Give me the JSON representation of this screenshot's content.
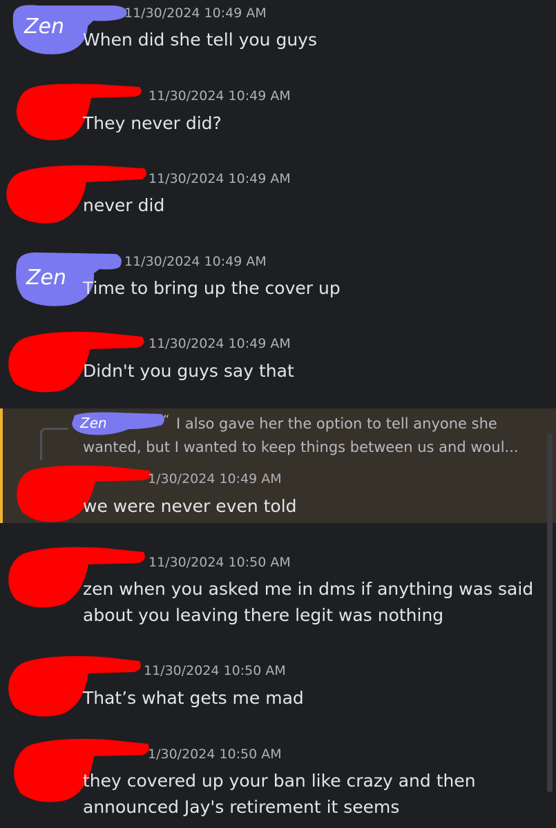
{
  "messages": [
    {
      "author": "Zen",
      "timestamp": "11/30/2024 10:49 AM",
      "lines": [
        "When did she tell you guys"
      ]
    },
    {
      "author": "",
      "timestamp": "11/30/2024 10:49 AM",
      "lines": [
        "They never did?"
      ]
    },
    {
      "author": "",
      "timestamp": "11/30/2024 10:49 AM",
      "lines": [
        "never did"
      ]
    },
    {
      "author": "Zen",
      "timestamp": "11/30/2024 10:49 AM",
      "lines": [
        "Time to bring up the cover up"
      ]
    },
    {
      "author": "",
      "timestamp": "11/30/2024 10:49 AM",
      "lines": [
        "Didn't you guys say that"
      ]
    },
    {
      "author": "",
      "timestamp": "1/30/2024 10:49 AM",
      "lines": [
        "we were never even told"
      ],
      "reply": {
        "author": "Zen",
        "quote_mark": "“",
        "text": "I also gave her the option to tell anyone she wanted, but I wanted to keep things between us and woul..."
      }
    },
    {
      "author": "",
      "timestamp": "11/30/2024 10:50 AM",
      "lines": [
        "zen when you asked me in dms if anything was said",
        "about you leaving there legit was nothing"
      ]
    },
    {
      "author": "",
      "timestamp": "11/30/2024 10:50 AM",
      "lines": [
        "That’s what gets me mad"
      ]
    },
    {
      "author": "",
      "timestamp": "1/30/2024 10:50 AM",
      "lines": [
        "they covered up your ban like crazy and then",
        "announced Jay's retirement it seems"
      ]
    }
  ],
  "colors": {
    "background": "#1e1f22",
    "highlight": "#36322a",
    "highlight_bar": "#f0b232",
    "redaction_red": "#ff0000",
    "zen_purple": "#7b79ef"
  }
}
